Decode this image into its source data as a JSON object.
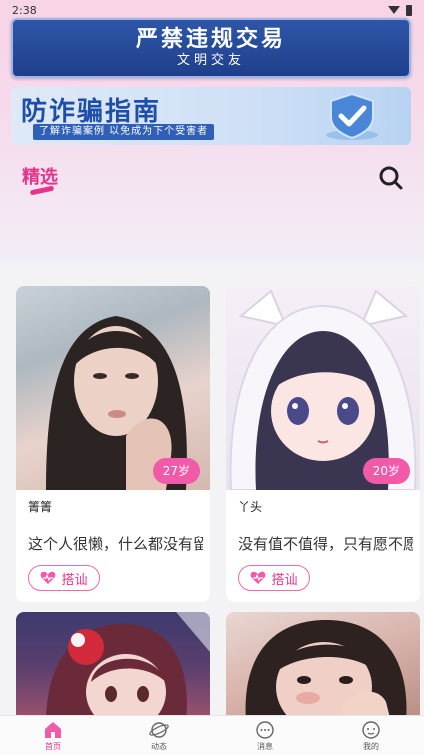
{
  "status_bar": {
    "time": "2:38"
  },
  "banner_rules": {
    "title": "严禁违规交易",
    "subtitle": "文明交友"
  },
  "banner_fraud": {
    "title": "防诈骗指南",
    "subtitle": "了解诈骗案例 以免成为下个受害者"
  },
  "header": {
    "tab_label": "精选"
  },
  "cards": [
    {
      "name": "箐箐",
      "age": "27岁",
      "bio": "这个人很懒，什么都没有留下",
      "chat_label": "搭讪"
    },
    {
      "name": "丫头",
      "age": "20岁",
      "bio": "没有值不值得，只有愿不愿意",
      "chat_label": "搭讪"
    }
  ],
  "bottom_nav": {
    "items": [
      {
        "label": "首页",
        "icon": "home-icon",
        "active": true
      },
      {
        "label": "动态",
        "icon": "planet-icon",
        "active": false
      },
      {
        "label": "消息",
        "icon": "message-icon",
        "active": false
      },
      {
        "label": "我的",
        "icon": "profile-icon",
        "active": false
      }
    ]
  },
  "colors": {
    "accent": "#e8338b",
    "badge": "#f05aa8",
    "banner_blue": "#1f3f8c"
  }
}
